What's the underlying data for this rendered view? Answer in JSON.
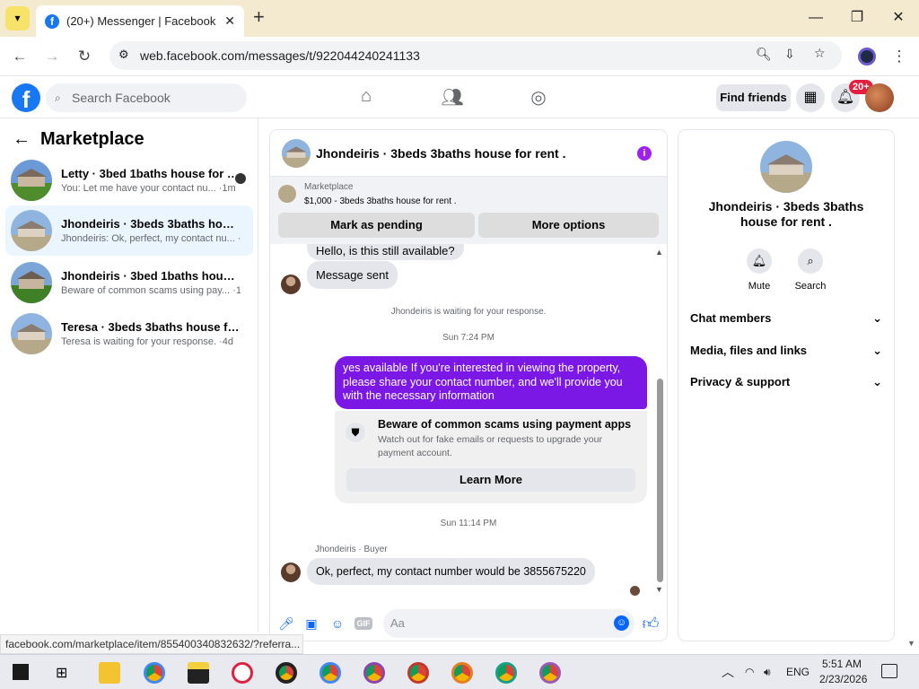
{
  "browser": {
    "tab_title": "(20+) Messenger | Facebook",
    "url": "web.facebook.com/messages/t/922044240241133",
    "new_tab": "+",
    "status_url": "facebook.com/marketplace/item/855400340832632/?referra..."
  },
  "fb": {
    "logo": "f",
    "search_placeholder": "Search Facebook",
    "find_friends": "Find friends",
    "notif_badge": "20+"
  },
  "left": {
    "title": "Marketplace",
    "conversations": [
      {
        "name": "Letty · 3bed 1baths house for re...",
        "preview": "You: Let me have your contact nu... ·1m"
      },
      {
        "name": "Jhondeiris · 3beds 3baths house fo...",
        "preview": "Jhondeiris: Ok, perfect, my contact nu... ·6h"
      },
      {
        "name": "Jhondeiris · 3bed 1baths house for...",
        "preview": "Beware of common scams using pay... ·10h"
      },
      {
        "name": "Teresa · 3beds 3baths house for re...",
        "preview": "Teresa is waiting for your response. ·4d"
      }
    ]
  },
  "chat": {
    "header_name": "Jhondeiris · 3beds 3baths house for rent .",
    "mp_label": "Marketplace",
    "mp_item": "$1,000 - 3beds 3baths house for rent .",
    "mark_pending": "Mark as pending",
    "more_options": "More options",
    "msg_hello": "Hello, is this still available?",
    "msg_sent": "Message sent",
    "waiting": "Jhondeiris is waiting for your response.",
    "time1": "Sun 7:24 PM",
    "out_msg": "yes available  If you're interested in viewing the property, please share your contact number, and we'll provide you with the necessary information",
    "scam_title": "Beware of common scams using payment apps",
    "scam_body": "Watch out for fake emails or requests to upgrade your payment account.",
    "learn_more": "Learn More",
    "time2": "Sun 11:14 PM",
    "buyer_label": "Jhondeiris · Buyer",
    "buyer_msg": "Ok, perfect, my contact number would be 3855675220",
    "composer_placeholder": "Aa"
  },
  "right": {
    "name": "Jhondeiris · 3beds 3baths house for rent .",
    "mute": "Mute",
    "search": "Search",
    "rows": [
      "Chat members",
      "Media, files and links",
      "Privacy & support"
    ]
  },
  "taskbar": {
    "lang": "ENG",
    "time": "5:51 AM",
    "date": "2/23/2026"
  },
  "colors": {
    "fb_blue": "#1877f2",
    "accent_purple": "#7b18e6",
    "active_row": "#ebf5ff"
  }
}
